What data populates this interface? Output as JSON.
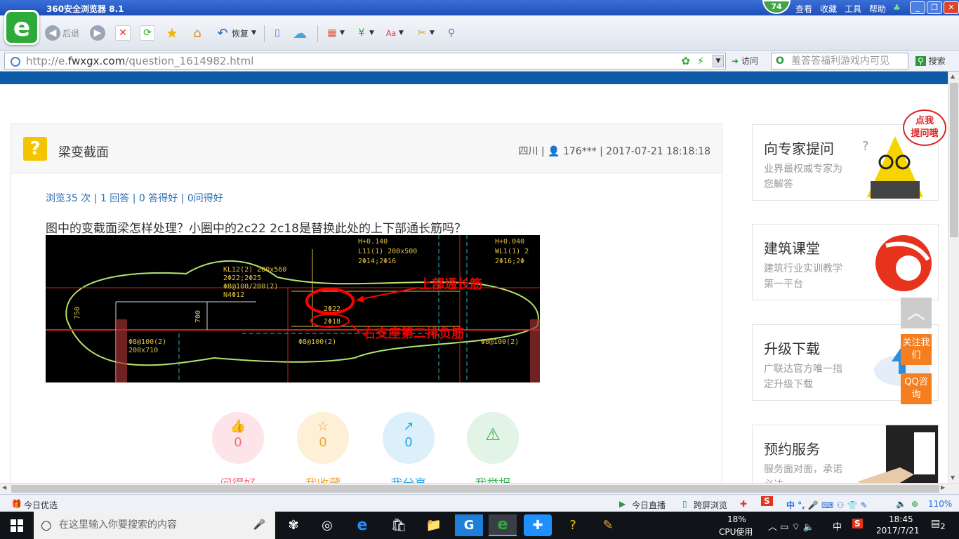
{
  "browser": {
    "title": "360安全浏览器 8.1",
    "badge": "74",
    "menu": [
      "查看",
      "收藏",
      "工具",
      "帮助"
    ],
    "toolbar": {
      "back": "后退",
      "restore": "恢复"
    },
    "address": {
      "url_prefix": "http://e.",
      "url_domain": "fwxgx.com",
      "url_path": "/question_1614982.html",
      "visit": "访问"
    },
    "search": {
      "placeholder": "羞答答福利游戏内可见",
      "button": "搜索"
    }
  },
  "question": {
    "title": "梁变截面",
    "meta": "四川 | 👤 176*** | 2017-07-21 18:18:18",
    "stats": "浏览35 次 | 1 回答 | 0 答得好 | 0问得好",
    "text": "图中的变截面梁怎样处理？小圈中的2c22   2c18是替换此处的上下部通长筋吗？",
    "image_labels": {
      "top_bar": "上部通长筋",
      "right_support": "右支座第二排负筋"
    },
    "actions": [
      {
        "label": "问得好",
        "count": "0",
        "icon": "thumb-up-icon",
        "color": "#f36b7f"
      },
      {
        "label": "我收藏",
        "count": "0",
        "icon": "star-icon",
        "color": "#f0a53a"
      },
      {
        "label": "我分享",
        "count": "0",
        "icon": "share-icon",
        "color": "#2aa4e6"
      },
      {
        "label": "我举报",
        "count": "",
        "icon": "warning-icon",
        "color": "#3aae5a"
      }
    ]
  },
  "sidebar": {
    "bubble": "点我\n提问哦",
    "cards": [
      {
        "title": "向专家提问",
        "desc": "业界最权威专家为您解答"
      },
      {
        "title": "建筑课堂",
        "desc": "建筑行业实训教学第一平台"
      },
      {
        "title": "升级下载",
        "desc": "广联达官方唯一指定升级下载"
      },
      {
        "title": "预约服务",
        "desc": "服务面对面，承诺必达"
      }
    ],
    "follow": "关注我们",
    "qq": "QQ咨询"
  },
  "statusbar": {
    "left": "今日优选",
    "live": "今日直播",
    "screen": "跨屏浏览",
    "zoom": "110%"
  },
  "taskbar": {
    "search_placeholder": "在这里输入你要搜索的内容",
    "cpu_percent": "18%",
    "cpu_label": "CPU使用",
    "ime": "中",
    "time": "18:45",
    "date": "2017/7/21",
    "notifications": "2"
  }
}
